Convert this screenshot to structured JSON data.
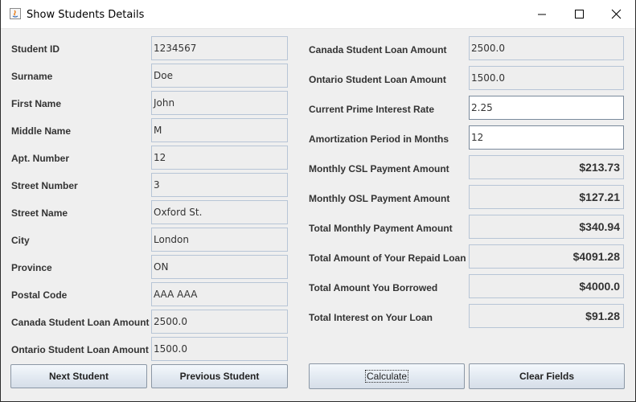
{
  "window": {
    "title": "Show Students Details"
  },
  "left": {
    "fields": [
      {
        "label": "Student ID",
        "value": "1234567"
      },
      {
        "label": "Surname",
        "value": "Doe"
      },
      {
        "label": "First Name",
        "value": "John"
      },
      {
        "label": "Middle Name",
        "value": "M"
      },
      {
        "label": "Apt. Number",
        "value": "12"
      },
      {
        "label": "Street Number",
        "value": "3"
      },
      {
        "label": "Street Name",
        "value": "Oxford St."
      },
      {
        "label": "City",
        "value": "London"
      },
      {
        "label": "Province",
        "value": "ON"
      },
      {
        "label": "Postal Code",
        "value": "AAA AAA"
      },
      {
        "label": "Canada Student Loan Amount",
        "value": "2500.0"
      },
      {
        "label": "Ontario Student Loan Amount",
        "value": "1500.0"
      }
    ],
    "next_button": "Next Student",
    "previous_button": "Previous Student"
  },
  "right": {
    "fields": [
      {
        "label": "Canada Student Loan Amount",
        "value": "2500.0"
      },
      {
        "label": "Ontario Student Loan Amount",
        "value": "1500.0"
      },
      {
        "label": "Current Prime Interest Rate",
        "value": "2.25"
      },
      {
        "label": "Amortization Period in Months",
        "value": "12"
      },
      {
        "label": "Monthly CSL Payment Amount",
        "value": "$213.73"
      },
      {
        "label": "Monthly OSL Payment Amount",
        "value": "$127.21"
      },
      {
        "label": "Total Monthly Payment Amount",
        "value": "$340.94"
      },
      {
        "label": "Total Amount of Your Repaid Loan",
        "value": "$4091.28"
      },
      {
        "label": "Total Amount You Borrowed",
        "value": "$4000.0"
      },
      {
        "label": "Total Interest on Your Loan",
        "value": "$91.28"
      }
    ],
    "calculate_button": "Calculate",
    "clear_button": "Clear Fields"
  }
}
